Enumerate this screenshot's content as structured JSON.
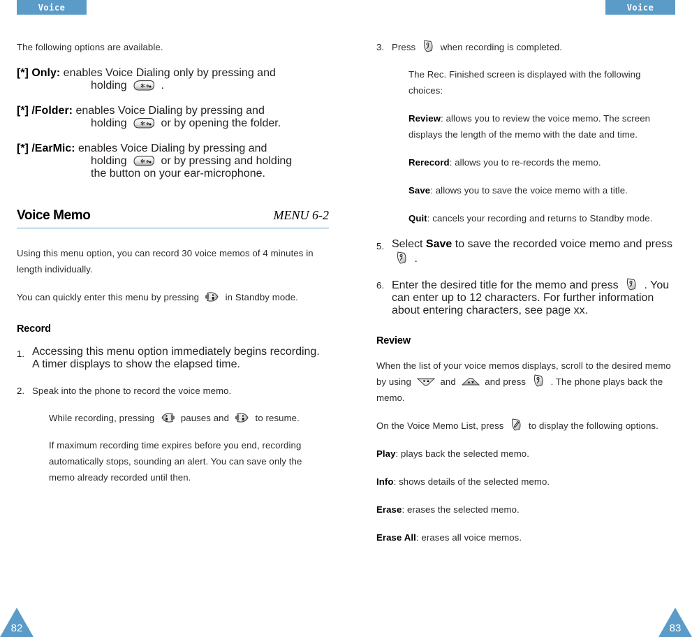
{
  "accent_color": "#5b9bc8",
  "left_page": {
    "tab_label": "Voice",
    "page_number": "82",
    "intro": "The following options are available.",
    "options": [
      {
        "term": "[*] Only:",
        "text_before": " enables Voice Dialing only by pressing and",
        "cont_before": "holding ",
        "icon": "star-key-icon",
        "cont_after": " ."
      },
      {
        "term": "[*] /Folder:",
        "text_before": " enables Voice Dialing by pressing and",
        "cont_before": "holding ",
        "icon": "star-key-icon",
        "cont_after": "  or by opening the folder."
      },
      {
        "term": "[*] /EarMic:",
        "text_before": " enables Voice Dialing by pressing and",
        "cont_before": "holding ",
        "icon": "star-key-icon",
        "cont_after": "  or by pressing and holding",
        "cont_line2": "the button on your ear-microphone."
      }
    ],
    "section": {
      "title": "Voice Memo",
      "menu": "MENU 6-2",
      "para1": "Using this menu option, you can record 30 voice memos of 4 minutes in length individually.",
      "para2_before": "You can quickly enter this menu by pressing ",
      "para2_icon": "side-key-right-icon",
      "para2_after": "  in Standby mode."
    },
    "record": {
      "heading": "Record",
      "step1_num": "1.",
      "step1_text": "Accessing this menu option immediately begins recording.  A timer displays to show the elapsed time.",
      "step2_num": "2.",
      "step2_text": "Speak into the phone to record the voice memo.",
      "step2_sub1_a": "While recording, pressing ",
      "step2_sub1_icon1": "side-key-left-icon",
      "step2_sub1_b": "  pauses and ",
      "step2_sub1_icon2": "side-key-right-icon",
      "step2_sub1_c": "  to resume.",
      "step2_sub2": "If maximum recording time expires before you end, recording automatically stops, sounding an alert. You can save only the memo already recorded until then."
    }
  },
  "right_page": {
    "tab_label": "Voice",
    "page_number": "83",
    "step3": {
      "num": "3.",
      "before": "Press ",
      "icon": "soft-key-select-icon",
      "after": "  when recording is completed.",
      "sub": "The Rec. Finished screen is displayed with the following choices:"
    },
    "choices": [
      {
        "term": "Review",
        "text": ": allows you to review the voice memo. The screen displays the length of the memo with the date and time."
      },
      {
        "term": "Rerecord",
        "text": ": allows you to re-records the memo."
      },
      {
        "term": "Save",
        "text": ": allows you to save the voice memo with a title."
      },
      {
        "term": "Quit",
        "text": ": cancels your recording and returns to Standby mode."
      }
    ],
    "step5": {
      "num": "5.",
      "a": "Select ",
      "bold": "Save",
      "b": " to save the recorded voice memo and press ",
      "icon": "soft-key-select-icon",
      "c": " ."
    },
    "step6": {
      "num": "6.",
      "a": "Enter the desired title for the memo and press ",
      "icon": "soft-key-select-icon",
      "b": " . You can enter up to 12 characters.  For further information about entering characters, see page xx."
    },
    "review": {
      "heading": "Review",
      "para1_a": "When the list of your voice memos displays, scroll to the desired memo by using ",
      "para1_icon1": "nav-up-key-icon",
      "para1_b": "  and ",
      "para1_icon2": "nav-down-key-icon",
      "para1_c": "  and press ",
      "para1_icon3": "soft-key-select-icon",
      "para1_d": " . The phone plays back the memo.",
      "para2_a": "On the Voice Memo List, press ",
      "para2_icon": "soft-key-options-icon",
      "para2_b": "  to display the following options.",
      "options": [
        {
          "term": "Play",
          "text": ": plays back the selected memo."
        },
        {
          "term": "Info",
          "text": ": shows details of the selected memo."
        },
        {
          "term": "Erase",
          "text": ": erases the selected memo."
        },
        {
          "term": "Erase All",
          "text": ": erases all voice memos."
        }
      ]
    }
  }
}
